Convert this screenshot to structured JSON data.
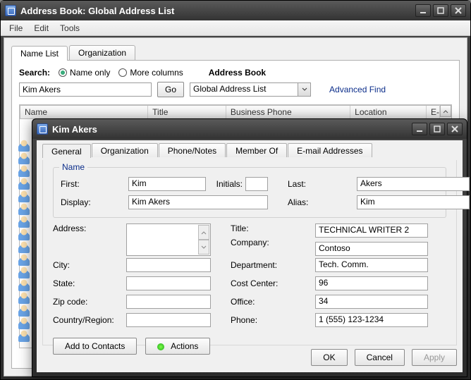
{
  "outerWindow": {
    "title": "Address Book: Global Address List",
    "menus": {
      "file": "File",
      "edit": "Edit",
      "tools": "Tools"
    }
  },
  "mainTabs": {
    "nameList": "Name List",
    "organization": "Organization"
  },
  "search": {
    "label": "Search:",
    "optNameOnly": "Name only",
    "optMoreColumns": "More columns",
    "abLabel": "Address Book",
    "value": "Kim Akers",
    "goLabel": "Go",
    "abValue": "Global Address List",
    "advancedFind": "Advanced Find"
  },
  "gridHeaders": {
    "name": "Name",
    "title": "Title",
    "businessPhone": "Business Phone",
    "location": "Location",
    "email": "E-mail"
  },
  "dialog": {
    "title": "Kim Akers",
    "tabs": {
      "general": "General",
      "organization": "Organization",
      "phoneNotes": "Phone/Notes",
      "memberOf": "Member Of",
      "emailAddresses": "E-mail Addresses"
    },
    "nameLegend": "Name",
    "labels": {
      "first": "First:",
      "initials": "Initials:",
      "last": "Last:",
      "display": "Display:",
      "alias": "Alias:",
      "address": "Address:",
      "title": "Title:",
      "company": "Company:",
      "city": "City:",
      "department": "Department:",
      "state": "State:",
      "costCenter": "Cost Center:",
      "zip": "Zip code:",
      "office": "Office:",
      "country": "Country/Region:",
      "phone": "Phone:"
    },
    "values": {
      "first": "Kim",
      "initials": "",
      "last": "Akers",
      "display": "Kim Akers",
      "alias": "Kim",
      "address": "",
      "title": "TECHNICAL WRITER 2",
      "company": "Contoso",
      "city": "",
      "department": "Tech. Comm.",
      "state": "",
      "costCenter": "96",
      "zip": "",
      "office": "34",
      "country": "",
      "phone": "1 (555) 123-1234"
    },
    "buttons": {
      "addToContacts": "Add to Contacts",
      "actions": "Actions",
      "ok": "OK",
      "cancel": "Cancel",
      "apply": "Apply"
    }
  }
}
